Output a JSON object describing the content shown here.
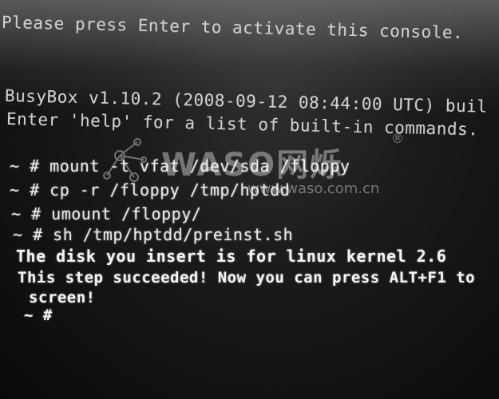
{
  "console": {
    "activate_line": "Please press Enter to activate this console.",
    "banner_line": "BusyBox v1.10.2 (2008-09-12 08:44:00 UTC) buil",
    "help_line": "Enter 'help' for a list of built-in commands.",
    "commands": [
      "~ # mount -t vfat /dev/sda /floppy",
      "~ # cp -r /floppy /tmp/hptdd",
      "~ # umount /floppy/",
      "~ # sh /tmp/hptdd/preinst.sh"
    ],
    "output": [
      "The disk you insert is for linux kernel 2.6",
      "This step succeeded! Now you can press ALT+F1 to",
      "screen!"
    ],
    "prompt": "~ #"
  },
  "watermark": {
    "brand": "WASO网烁",
    "registered": "®",
    "url": "www.waso.com.cn"
  },
  "colors": {
    "text": "#e9e9e9",
    "background": "#0b0b0b"
  }
}
